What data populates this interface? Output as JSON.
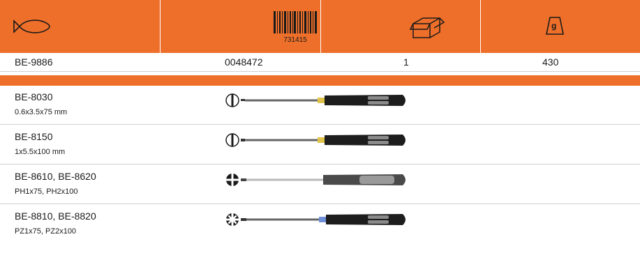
{
  "header": {
    "icons": [
      "fish-icon",
      "barcode-icon",
      "box-icon",
      "weight-icon"
    ],
    "barcode_number": "731415",
    "weight_label": "g",
    "color": "#ee6f2a"
  },
  "values_row": {
    "article": "BE-9886",
    "ean": "0048472",
    "pack_qty": "1",
    "weight": "430"
  },
  "products": [
    {
      "name": "BE-8030",
      "size": "0.6x3.5x75 mm",
      "tip": "slotted-tip-icon"
    },
    {
      "name": "BE-8150",
      "size": "1x5.5x100 mm",
      "tip": "slotted-tip-icon"
    },
    {
      "name": "BE-8610, BE-8620",
      "size": "PH1x75, PH2x100",
      "tip": "phillips-tip-icon"
    },
    {
      "name": "BE-8810, BE-8820",
      "size": "PZ1x75, PZ2x100",
      "tip": "pozidriv-tip-icon"
    }
  ]
}
